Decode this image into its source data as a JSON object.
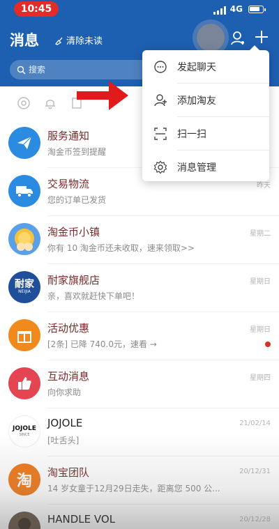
{
  "status_bar": {
    "time": "10:45",
    "network": "4G"
  },
  "header": {
    "title": "消息",
    "clear_unread": "清除未读",
    "search_placeholder": "搜索"
  },
  "menu": {
    "items": [
      {
        "label": "发起聊天",
        "icon": "chat-bubble-icon"
      },
      {
        "label": "添加淘友",
        "icon": "add-friend-icon"
      },
      {
        "label": "扫一扫",
        "icon": "scan-icon"
      },
      {
        "label": "消息管理",
        "icon": "gear-icon"
      }
    ]
  },
  "messages": [
    {
      "title": "服务通知",
      "subtitle": "淘金币签到提醒",
      "time": "",
      "avatar": "paper-plane-icon",
      "color": "#2b8be0"
    },
    {
      "title": "交易物流",
      "subtitle": "您的订单已发货",
      "time": "昨天",
      "avatar": "truck-icon",
      "color": "#2b8be0"
    },
    {
      "title": "淘金币小镇",
      "subtitle": "你有 10 淘金币还未收取，速来领取>>",
      "time": "星期二",
      "avatar": "coin-character",
      "color": "#5aa0e8"
    },
    {
      "title": "耐家旗舰店",
      "subtitle": "亲，喜欢就赶快下单吧！",
      "time": "星期日",
      "avatar": "naijia-logo",
      "color": "#1f4f9a",
      "logo_text": "耐家",
      "logo_sub": "NEIJIA"
    },
    {
      "title": "活动优惠",
      "subtitle": "[2条] 已降 740.0元，速看 →",
      "time": "星期日",
      "avatar": "gift-icon",
      "color": "#f08a1c",
      "unread": true
    },
    {
      "title": "互动消息",
      "subtitle": "向你求助",
      "time": "星期四",
      "avatar": "thumbs-up-icon",
      "color": "#e54552"
    },
    {
      "title": "JOJOLE",
      "subtitle": "[吐舌头]",
      "time": "21/02/14",
      "avatar": "jojole-logo",
      "color": "#ffffff",
      "logo_text": "JOJOLE",
      "logo_sub": "SINCE"
    },
    {
      "title": "淘宝团队",
      "subtitle": "14 岁女童于12月29日走失，距离您 500 公...",
      "time": "20/12/31",
      "avatar": "tao-icon",
      "color": "#f07a1c",
      "logo_text": "淘"
    },
    {
      "title": "HANDLE VOL",
      "subtitle": "",
      "time": "20/12/28",
      "avatar": "store-photo",
      "color": "#6b5a4a"
    }
  ],
  "colors": {
    "header_bg": "#1d5fb0",
    "title_text": "#7a2a2a",
    "arrow": "#e11b1b",
    "unread": "#d93025"
  }
}
